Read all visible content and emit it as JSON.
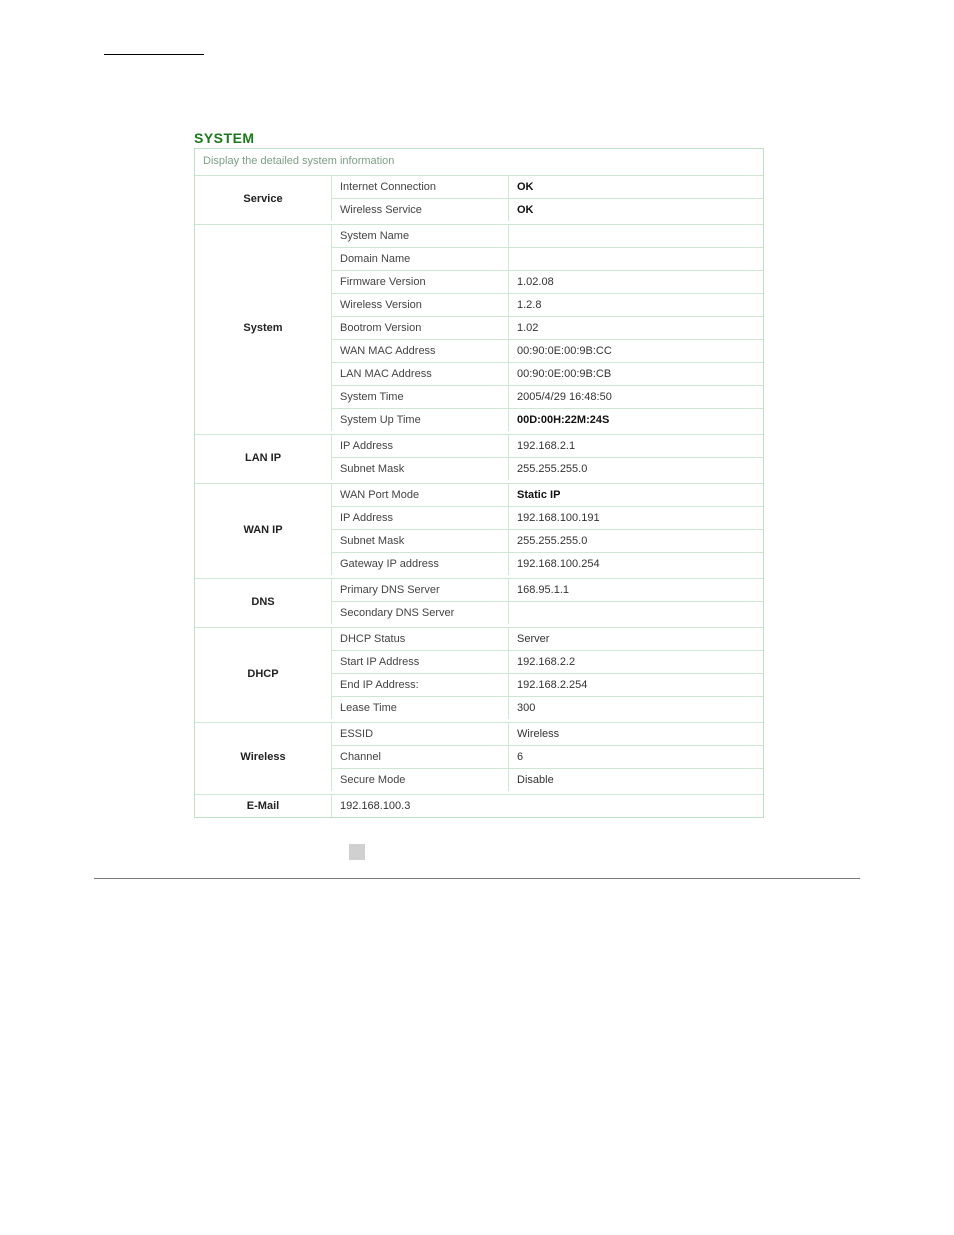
{
  "title": "SYSTEM",
  "subtitle": "Display the detailed system information",
  "sections": {
    "service": {
      "label": "Service",
      "rows": [
        {
          "k": "Internet Connection",
          "v": "OK",
          "bold": true
        },
        {
          "k": "Wireless Service",
          "v": "OK",
          "bold": true
        }
      ]
    },
    "system": {
      "label": "System",
      "rows": [
        {
          "k": "System Name",
          "v": ""
        },
        {
          "k": "Domain Name",
          "v": ""
        },
        {
          "k": "Firmware Version",
          "v": "1.02.08"
        },
        {
          "k": "Wireless Version",
          "v": "1.2.8"
        },
        {
          "k": "Bootrom Version",
          "v": "1.02"
        },
        {
          "k": "WAN MAC Address",
          "v": "00:90:0E:00:9B:CC"
        },
        {
          "k": "LAN MAC Address",
          "v": "00:90:0E:00:9B:CB"
        },
        {
          "k": "System Time",
          "v": "2005/4/29   16:48:50"
        },
        {
          "k": "System Up Time",
          "v": "00D:00H:22M:24S",
          "bold": true
        }
      ]
    },
    "lanip": {
      "label": "LAN IP",
      "rows": [
        {
          "k": "IP Address",
          "v": "192.168.2.1"
        },
        {
          "k": "Subnet Mask",
          "v": "255.255.255.0"
        }
      ]
    },
    "wanip": {
      "label": "WAN IP",
      "rows": [
        {
          "k": "WAN Port Mode",
          "v": "Static IP",
          "bold": true
        },
        {
          "k": "IP Address",
          "v": "192.168.100.191"
        },
        {
          "k": "Subnet Mask",
          "v": "255.255.255.0"
        },
        {
          "k": "Gateway IP address",
          "v": "192.168.100.254"
        }
      ]
    },
    "dns": {
      "label": "DNS",
      "rows": [
        {
          "k": "Primary DNS Server",
          "v": "168.95.1.1"
        },
        {
          "k": "Secondary DNS Server",
          "v": ""
        }
      ]
    },
    "dhcp": {
      "label": "DHCP",
      "rows": [
        {
          "k": "DHCP Status",
          "v": "Server"
        },
        {
          "k": "Start IP Address",
          "v": "192.168.2.2"
        },
        {
          "k": "End IP Address:",
          "v": "192.168.2.254"
        },
        {
          "k": "Lease Time",
          "v": "300"
        }
      ]
    },
    "wireless": {
      "label": "Wireless",
      "rows": [
        {
          "k": "ESSID",
          "v": "Wireless"
        },
        {
          "k": "Channel",
          "v": "6"
        },
        {
          "k": "Secure Mode",
          "v": "Disable"
        }
      ]
    },
    "email": {
      "label": "E-Mail",
      "value": "192.168.100.3"
    }
  }
}
